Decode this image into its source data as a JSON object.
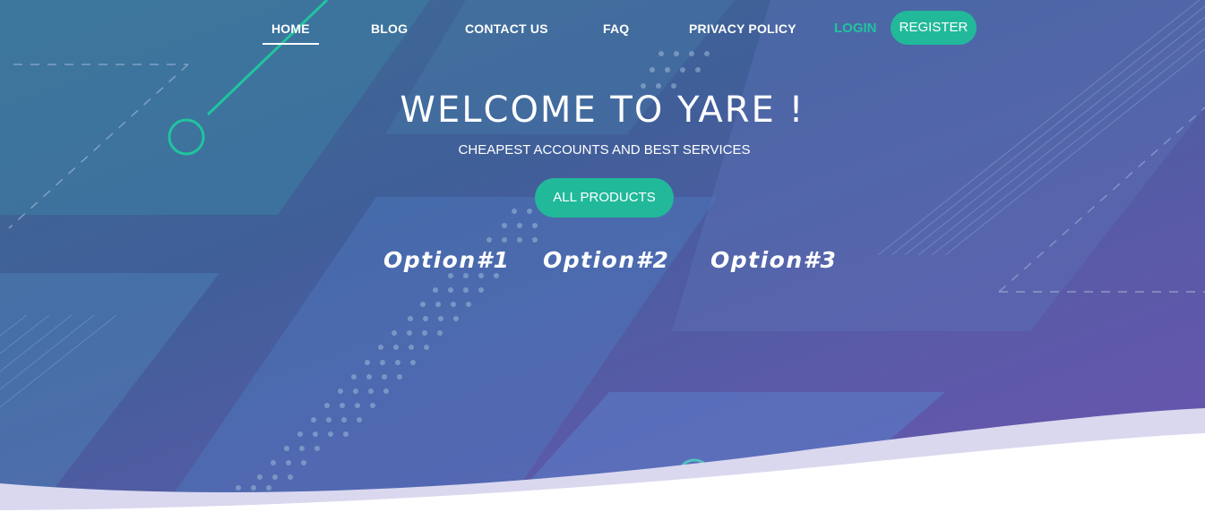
{
  "nav": {
    "items": [
      {
        "label": "HOME",
        "active": true
      },
      {
        "label": "BLOG",
        "active": false
      },
      {
        "label": "CONTACT US",
        "active": false
      },
      {
        "label": "FAQ",
        "active": false
      },
      {
        "label": "PRIVACY POLICY",
        "active": false
      }
    ],
    "login": "LOGIN",
    "register": "REGISTER"
  },
  "hero": {
    "title": "WELCOME TO YARE !",
    "subtitle": "CHEAPEST ACCOUNTS AND BEST SERVICES",
    "cta": "ALL PRODUCTS",
    "options": [
      "Option#1",
      "Option#2",
      "Option#3"
    ]
  },
  "colors": {
    "accent": "#21b99a",
    "text": "#ffffff"
  }
}
